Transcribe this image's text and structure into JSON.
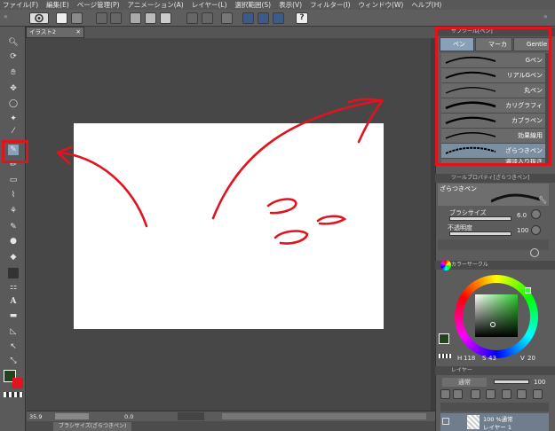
{
  "menubar": {
    "items": [
      "ファイル(F)",
      "編集(E)",
      "ページ管理(P)",
      "アニメーション(A)",
      "レイヤー(L)",
      "選択範囲(S)",
      "表示(V)",
      "フィルター(I)",
      "ウィンドウ(W)",
      "ヘルプ(H)"
    ]
  },
  "canvas_tab": {
    "label": "イラスト2"
  },
  "status": {
    "zoom": "35.9",
    "angle": "0.0"
  },
  "bottom_tab": {
    "label": "ブラシサイズ(ざらつきペン)"
  },
  "subtool_panel": {
    "header": "サブツール[ペン]",
    "tabs": [
      "ペン",
      "マーカー",
      "Gentle"
    ],
    "brushes": [
      "Gペン",
      "リアルGペン",
      "丸ペン",
      "カリグラフィ",
      "カブラペン",
      "効果線用",
      "ざらつきペン",
      "濃淡入り抜き"
    ],
    "selected_index": 6
  },
  "tool_property": {
    "header": "ツールプロパティ[ざらつきペン]",
    "brush_name": "ざらつきペン",
    "size_label": "ブラシサイズ",
    "size_value": "6.0",
    "opacity_label": "不透明度",
    "opacity_value": "100"
  },
  "color_circle": {
    "header": "カラーサークル",
    "h": "118",
    "s": "43",
    "v": "20"
  },
  "layer_panel": {
    "header": "レイヤー",
    "blend_mode": "通常",
    "opacity": "100",
    "layer_info": "100 %通常",
    "layer_name": "レイヤー 1"
  },
  "colors": {
    "highlight": "#e0141e",
    "selected_brush": "#7b8fa0",
    "stroke": "#e0141e",
    "main_color": "#23431f"
  }
}
